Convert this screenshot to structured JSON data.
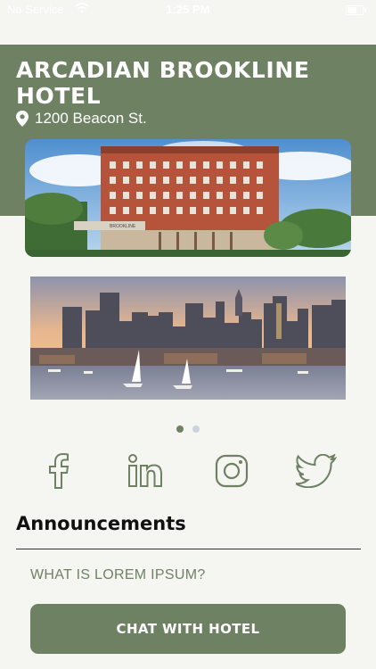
{
  "status_bar": {
    "carrier": "No Service",
    "time": "1:25 PM"
  },
  "hotel": {
    "name": "ARCADIAN BROOKLINE HOTEL",
    "address": "1200 Beacon St.",
    "sign_text": "BROOKLINE"
  },
  "gallery": {
    "page_count": 2,
    "current_page": 1
  },
  "social": [
    "facebook-icon",
    "linkedin-icon",
    "instagram-icon",
    "twitter-icon"
  ],
  "announcements": {
    "title": "Announcements",
    "items": [
      "WHAT IS LOREM IPSUM?"
    ]
  },
  "actions": {
    "chat_label": "CHAT WITH HOTEL"
  },
  "colors": {
    "accent": "#6f8163",
    "background": "#f5f5f2",
    "dot_inactive": "#c9d3dc"
  }
}
